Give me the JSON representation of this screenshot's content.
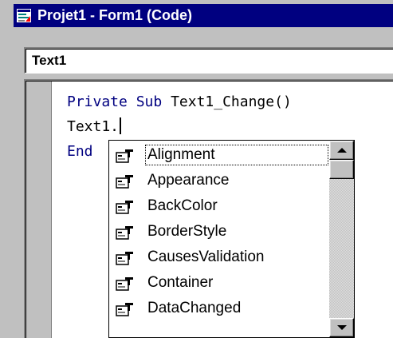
{
  "window": {
    "title": "Projet1 - Form1 (Code)"
  },
  "object_selector": {
    "value": "Text1"
  },
  "code": {
    "lines": [
      {
        "keyword1": "Private",
        "keyword2": "Sub",
        "rest": "Text1_Change()"
      },
      {
        "text": "Text1."
      },
      {
        "keyword": "End"
      }
    ]
  },
  "autocomplete": {
    "selected_index": 0,
    "items": [
      {
        "label": "Alignment",
        "icon": "property-icon"
      },
      {
        "label": "Appearance",
        "icon": "property-icon"
      },
      {
        "label": "BackColor",
        "icon": "property-icon"
      },
      {
        "label": "BorderStyle",
        "icon": "property-icon"
      },
      {
        "label": "CausesValidation",
        "icon": "property-icon"
      },
      {
        "label": "Container",
        "icon": "property-icon"
      },
      {
        "label": "DataChanged",
        "icon": "property-icon"
      }
    ]
  },
  "colors": {
    "titlebar": "#000080",
    "keyword": "#000080",
    "chrome": "#c0c0c0"
  }
}
